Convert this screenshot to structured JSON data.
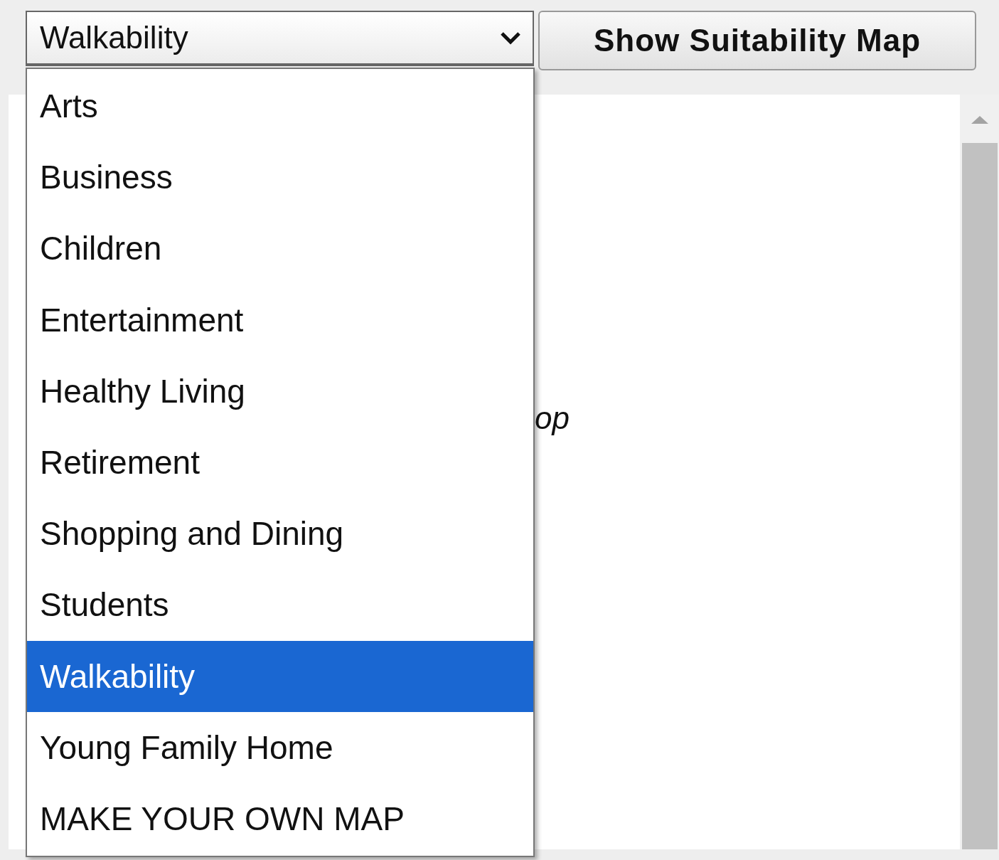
{
  "suitability_select": {
    "value": "Walkability",
    "expanded": true,
    "options": [
      {
        "label": "Arts",
        "selected": false
      },
      {
        "label": "Business",
        "selected": false
      },
      {
        "label": "Children",
        "selected": false
      },
      {
        "label": "Entertainment",
        "selected": false
      },
      {
        "label": "Healthy Living",
        "selected": false
      },
      {
        "label": "Retirement",
        "selected": false
      },
      {
        "label": "Shopping and Dining",
        "selected": false
      },
      {
        "label": "Students",
        "selected": false
      },
      {
        "label": "Walkability",
        "selected": true
      },
      {
        "label": "Young Family Home",
        "selected": false
      },
      {
        "label": "MAKE YOUR OWN MAP",
        "selected": false
      }
    ]
  },
  "show_button": "Show Suitability Map",
  "content_text": "op"
}
